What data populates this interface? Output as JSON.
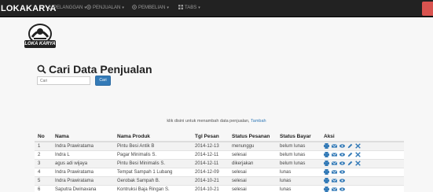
{
  "navbar": {
    "brand": "LOKAKARYA",
    "items": [
      {
        "label": "PELANGGAN",
        "icon": "user-icon"
      },
      {
        "label": "PENJUALAN",
        "icon": "globe-icon"
      },
      {
        "label": "PEMBELIAN",
        "icon": "globe-icon"
      },
      {
        "label": "TABS",
        "icon": "grid-icon"
      }
    ],
    "logout_color": "#d9534f"
  },
  "logo": {
    "text": "LOKA KARYA"
  },
  "search": {
    "title": "Cari Data Penjualan",
    "placeholder": "Cari",
    "button": "Cari"
  },
  "info": {
    "text": "klik disini untuk menambah data penjualan,",
    "link": "Tambah"
  },
  "table": {
    "headers": [
      "No",
      "Nama",
      "Nama Produk",
      "Tgl Pesan",
      "Status Pesanan",
      "Status Bayar",
      "Aksi"
    ],
    "rows": [
      {
        "no": "1",
        "nama": "Indra Prawiratama",
        "produk": "Pintu Besi Antik B",
        "tgl": "2014-12-13",
        "status": "menunggu",
        "bayar": "belum lunas",
        "actions": [
          "print-icon",
          "mail-icon",
          "eye-icon",
          "edit-icon",
          "delete-icon"
        ]
      },
      {
        "no": "2",
        "nama": "Indra L",
        "produk": "Pagar Minimalis S.",
        "tgl": "2014-12-11",
        "status": "selesai",
        "bayar": "belum lunas",
        "actions": [
          "print-icon",
          "mail-icon",
          "eye-icon",
          "edit-icon",
          "delete-icon"
        ]
      },
      {
        "no": "3",
        "nama": "agus adi wijaya",
        "produk": "Pintu Besi Minimalis S.",
        "tgl": "2014-12-11",
        "status": "dikerjakan",
        "bayar": "belum lunas",
        "actions": [
          "print-icon",
          "mail-icon",
          "eye-icon",
          "edit-icon",
          "delete-icon"
        ]
      },
      {
        "no": "4",
        "nama": "Indra Prawiratama",
        "produk": "Tempat Sampah 1 Lubang",
        "tgl": "2014-12-09",
        "status": "selesai",
        "bayar": "lunas",
        "actions": [
          "print-icon",
          "mail-icon",
          "eye-icon"
        ]
      },
      {
        "no": "5",
        "nama": "Indra Prawiratama",
        "produk": "Gerobak Sampah B.",
        "tgl": "2014-10-21",
        "status": "selesai",
        "bayar": "lunas",
        "actions": [
          "print-icon",
          "mail-icon",
          "eye-icon"
        ]
      },
      {
        "no": "6",
        "nama": "Saputra Dwinavana",
        "produk": "Kontruksi Baja Ringan S.",
        "tgl": "2014-10-21",
        "status": "selesai",
        "bayar": "lunas",
        "actions": [
          "print-icon",
          "mail-icon",
          "eye-icon"
        ]
      }
    ]
  },
  "colors": {
    "accent": "#337ab7",
    "danger": "#d9534f",
    "navbar": "#222222"
  }
}
